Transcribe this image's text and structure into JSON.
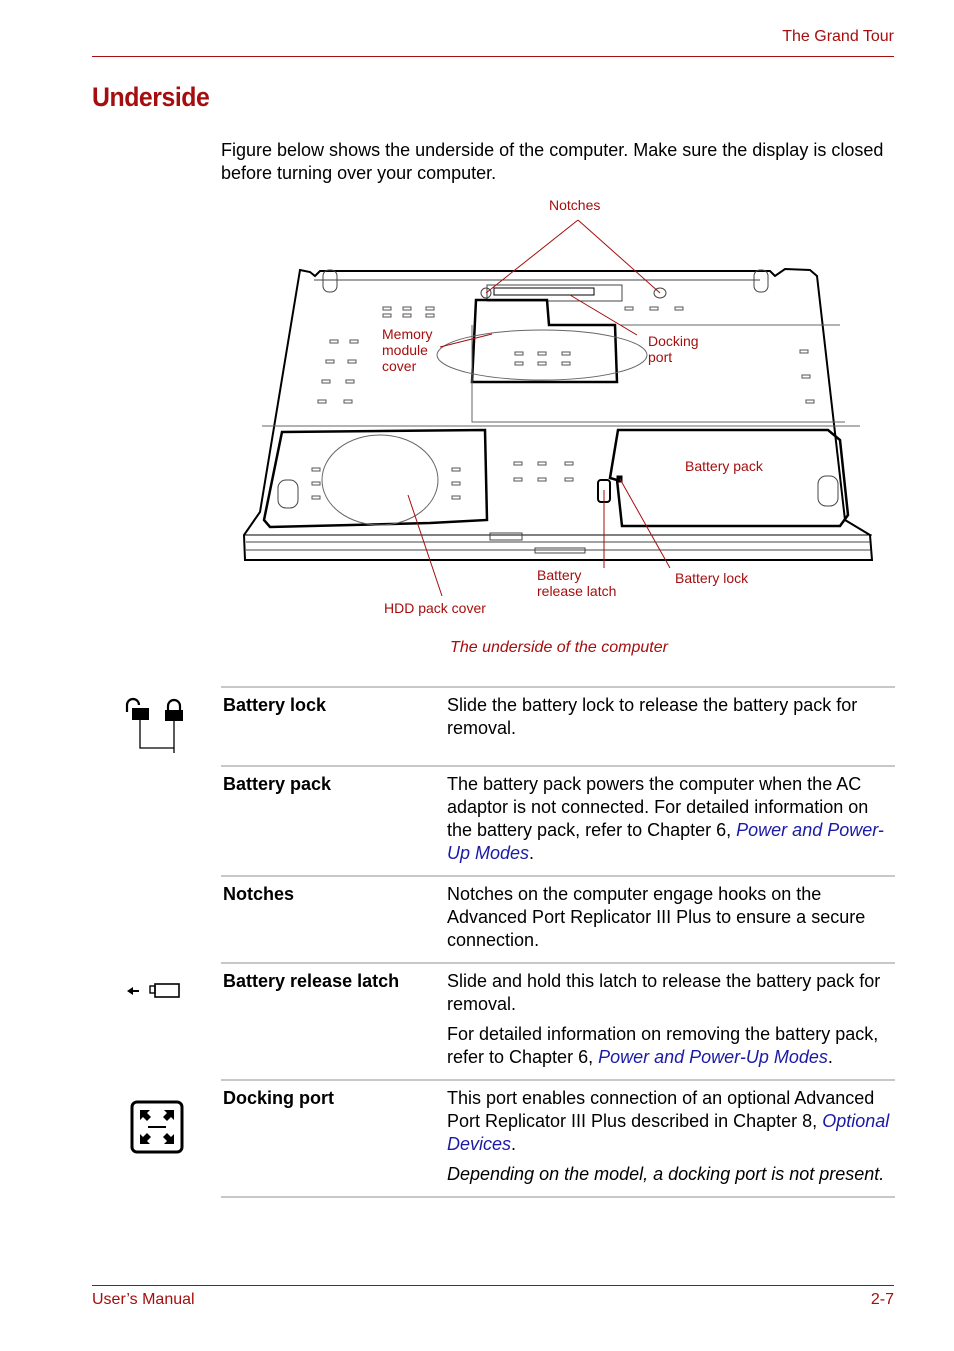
{
  "header": {
    "running_head": "The Grand Tour"
  },
  "page_title": "Underside",
  "intro": "Figure below shows the underside of the computer. Make sure the display is closed before turning over your computer.",
  "figure": {
    "labels": {
      "notches": "Notches",
      "memory_module_cover": "Memory\nmodule\ncover",
      "docking_port": "Docking\nport",
      "battery_pack": "Battery pack",
      "battery_release_latch": "Battery\nrelease latch",
      "battery_lock": "Battery lock",
      "hdd_pack_cover": "HDD pack cover"
    },
    "caption": "The underside of the computer"
  },
  "colors": {
    "accent_red": "#a50e0e",
    "link_blue": "#1a1aa6",
    "rule_gray": "#c8c8c8"
  },
  "items": [
    {
      "term": "Battery lock",
      "icon": "battery-lock-unlock-icon",
      "desc": [
        {
          "text": "Slide the battery lock to release the battery pack for removal."
        }
      ]
    },
    {
      "term": "Battery pack",
      "icon": null,
      "desc": [
        {
          "pre": "The battery pack powers the computer when the AC adaptor is not connected. For detailed information on the battery pack, refer to Chapter 6, ",
          "link": "Power and Power-Up Modes",
          "post": "."
        }
      ]
    },
    {
      "term": "Notches",
      "icon": null,
      "desc": [
        {
          "text": "Notches on the computer engage hooks on the Advanced Port Replicator III Plus to ensure a secure connection."
        }
      ]
    },
    {
      "term": "Battery release latch",
      "icon": "battery-release-icon",
      "desc": [
        {
          "text": "Slide and hold this latch to release the battery pack for removal."
        },
        {
          "pre": "For detailed information on removing the battery pack, refer to Chapter 6, ",
          "link": "Power and Power-Up Modes",
          "post": "."
        }
      ]
    },
    {
      "term": "Docking port",
      "icon": "docking-port-icon",
      "desc": [
        {
          "pre": "This port enables connection of an optional Advanced Port Replicator III Plus described in Chapter 8, ",
          "link": "Optional Devices",
          "post": "."
        },
        {
          "italic": "Depending on the model, a docking port is not present."
        }
      ]
    }
  ],
  "footer": {
    "left": "User’s Manual",
    "right": "2-7"
  }
}
